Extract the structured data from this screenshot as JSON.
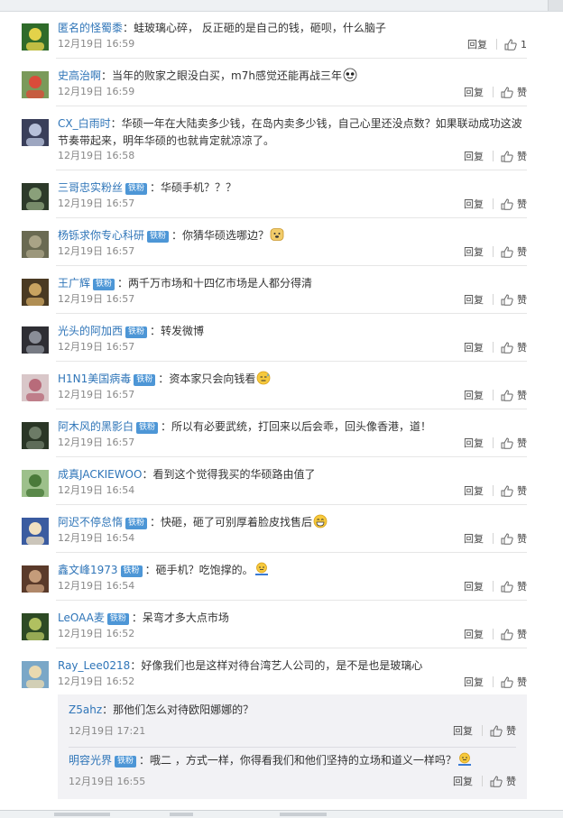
{
  "actions": {
    "reply_label": "回复",
    "like_label": "赞"
  },
  "comments": [
    {
      "user": "匿名的怪蜀黍",
      "badge": "",
      "text": "蛙玻璃心碎， 反正砸的是自己的钱，砸呗，什么脑子",
      "emoji": "",
      "time": "12月19日 16:59",
      "likes": "1"
    },
    {
      "user": "史高治啊",
      "badge": "",
      "text": "当年的败家之眼没白买，m7h感觉还能再战三年",
      "emoji": "panda-laugh-emoji",
      "time": "12月19日 16:59",
      "likes": "赞"
    },
    {
      "user": "CX_白雨时",
      "badge": "",
      "text": "华硕一年在大陆卖多少钱，在岛内卖多少钱，自己心里还没点数？如果联动成功这波",
      "text2": "节奏带起来，明年华硕的也就肯定就凉凉了。",
      "emoji": "",
      "time": "12月19日 16:58",
      "likes": "赞"
    },
    {
      "user": "三哥忠实粉丝",
      "badge": "铁粉",
      "text": "华硕手机？？？",
      "emoji": "",
      "time": "12月19日 16:57",
      "likes": "赞"
    },
    {
      "user": "杨铄求你专心科研",
      "badge": "铁粉",
      "text": "你猜华硕选哪边？",
      "emoji": "doge-emoji",
      "time": "12月19日 16:57",
      "likes": "赞"
    },
    {
      "user": "王广辉",
      "badge": "铁粉",
      "text": "两千万市场和十四亿市场是人都分得清",
      "emoji": "",
      "time": "12月19日 16:57",
      "likes": "赞"
    },
    {
      "user": "光头的阿加西",
      "badge": "铁粉",
      "text": "转发微博",
      "emoji": "",
      "time": "12月19日 16:57",
      "likes": "赞"
    },
    {
      "user": "H1N1美国病毒",
      "badge": "铁粉",
      "text": "资本家只会向钱看",
      "emoji": "sweat-emoji",
      "time": "12月19日 16:57",
      "likes": "赞"
    },
    {
      "user": "阿木风的黑影白",
      "badge": "铁粉",
      "text": "所以有必要武统，打回来以后会乖，回头像香港，道！",
      "emoji": "",
      "time": "12月19日 16:57",
      "likes": "赞"
    },
    {
      "user": "成真JACKIEWOO",
      "badge": "",
      "text": "看到这个觉得我买的华硕路由值了",
      "emoji": "",
      "time": "12月19日 16:54",
      "likes": "赞"
    },
    {
      "user": "阿迟不停怠惰",
      "badge": "铁粉",
      "text": "快砸，砸了可别厚着脸皮找售后",
      "emoji": "grin-emoji",
      "time": "12月19日 16:54",
      "likes": "赞"
    },
    {
      "user": "鑫文峰1973",
      "badge": "铁粉",
      "text": "砸手机？吃饱撑的。",
      "emoji": "shrug-emoji",
      "time": "12月19日 16:54",
      "likes": "赞"
    },
    {
      "user": "LeOAA麦",
      "badge": "铁粉",
      "text": "呆弯才多大点市场",
      "emoji": "",
      "time": "12月19日 16:52",
      "likes": "赞"
    },
    {
      "user": "Ray_Lee0218",
      "badge": "",
      "text": "好像我们也是这样对待台湾艺人公司的，是不是也是玻璃心",
      "emoji": "",
      "time": "12月19日 16:52",
      "likes": "赞"
    }
  ],
  "replies": [
    {
      "user": "Z5ahz",
      "badge": "",
      "text": "那他们怎么对待欧阳娜娜的？",
      "emoji": "",
      "time": "12月19日 17:21",
      "likes": "赞"
    },
    {
      "user": "明容光界",
      "badge": "铁粉",
      "text": "哦二 ，方式一样，你得看我们和他们坚持的立场和道义一样吗？",
      "emoji": "shrug-emoji",
      "time": "12月19日 16:55",
      "likes": "赞"
    }
  ]
}
